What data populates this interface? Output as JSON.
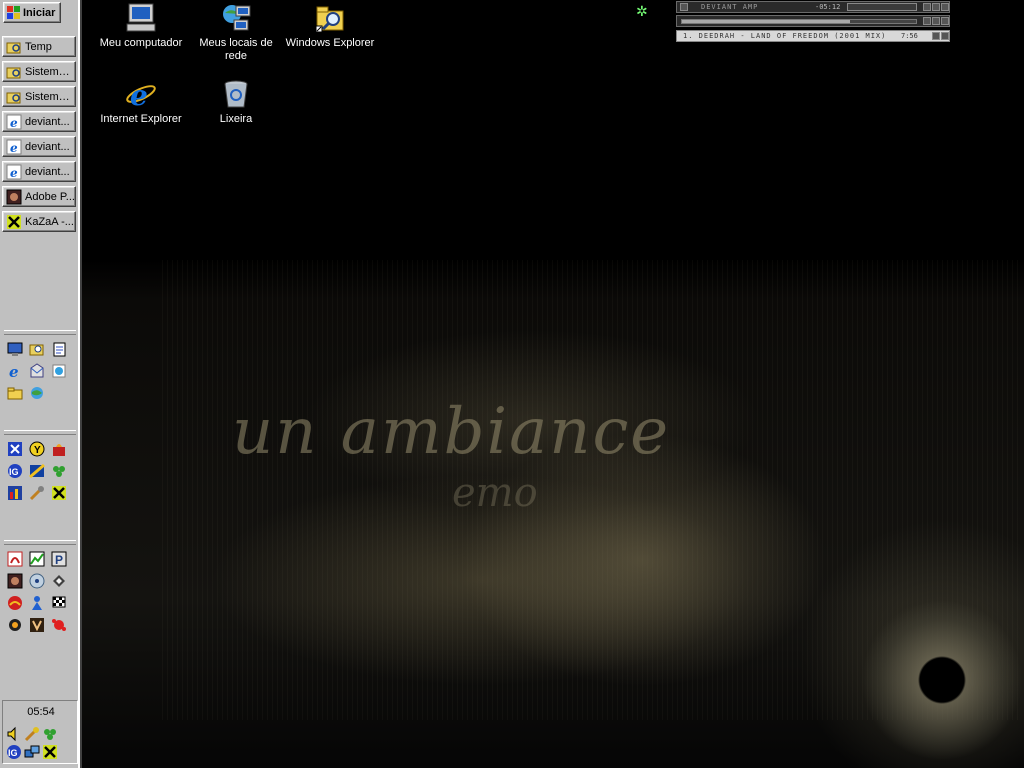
{
  "start": {
    "label": "Iniciar"
  },
  "taskbar": {
    "buttons": [
      {
        "label": "Temp",
        "icon": "explorer-folder-icon"
      },
      {
        "label": "Sistema ...",
        "icon": "explorer-folder-icon"
      },
      {
        "label": "Sistema ...",
        "icon": "explorer-folder-icon"
      },
      {
        "label": "deviant...",
        "icon": "internet-explorer-icon"
      },
      {
        "label": "deviant...",
        "icon": "internet-explorer-icon"
      },
      {
        "label": "deviant...",
        "icon": "internet-explorer-icon"
      },
      {
        "label": "Adobe P...",
        "icon": "photoshop-icon"
      },
      {
        "label": "KaZaA -...",
        "icon": "kazaa-icon"
      }
    ]
  },
  "tray": {
    "clock": "05:54"
  },
  "desktop": {
    "icons": [
      {
        "label": "Meu computador",
        "icon": "my-computer-icon"
      },
      {
        "label": "Meus locais de rede",
        "icon": "network-places-icon"
      },
      {
        "label": "Windows Explorer",
        "icon": "windows-explorer-icon"
      },
      {
        "label": "Internet Explorer",
        "icon": "internet-explorer-icon"
      },
      {
        "label": "Lixeira",
        "icon": "recycle-bin-icon"
      }
    ]
  },
  "winamp": {
    "title": "DEVIANT AMP",
    "time": "-05:12",
    "progress": 0.72,
    "track": "1. DEEDRAH - LAND OF FREEDOM (2001 MIX)",
    "duration": "7:56"
  },
  "wallpaper": {
    "text": "un ambiance",
    "text2": "emo"
  },
  "colors": {
    "taskbar": "#c0c0c0",
    "desktop": "#000000",
    "label_text": "#ffffff"
  }
}
